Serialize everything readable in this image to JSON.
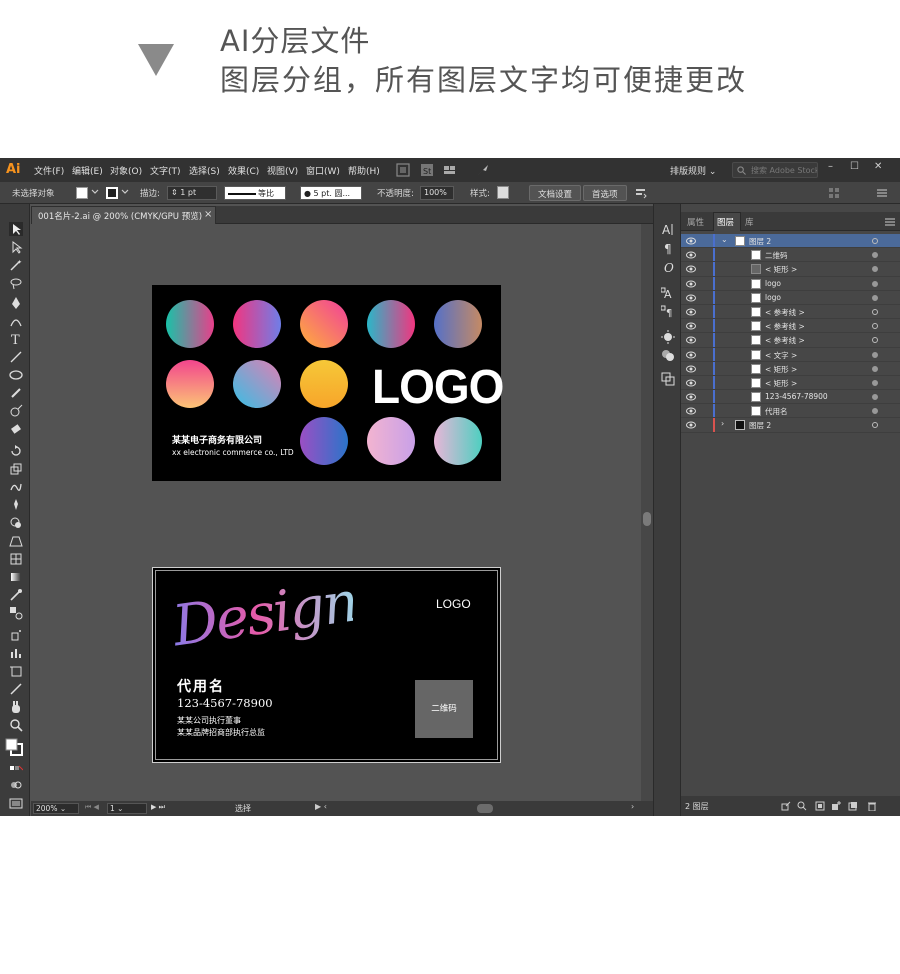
{
  "caption": {
    "line1": "AI分层文件",
    "line2": "图层分组，所有图层文字均可便捷更改",
    "arrow_icon": "down-triangle"
  },
  "menubar": {
    "app_logo": "Ai",
    "menus": [
      "文件(F)",
      "编辑(E)",
      "对象(O)",
      "文字(T)",
      "选择(S)",
      "效果(C)",
      "视图(V)",
      "窗口(W)",
      "帮助(H)"
    ],
    "workspace": "排版规则",
    "search_placeholder": "搜索 Adobe Stock"
  },
  "controlbar": {
    "selection": "未选择对象",
    "stroke_label": "描边:",
    "stroke_weight": "1 pt",
    "profile": "等比",
    "brush": "5 pt. 圆...",
    "opacity_label": "不透明度:",
    "opacity_value": "100%",
    "style_label": "样式:",
    "doc_setup": "文档设置",
    "preferences": "首选项"
  },
  "document": {
    "tab_title": "001名片-2.ai @ 200% (CMYK/GPU 预览)",
    "zoom": "200%",
    "page": "1",
    "status_tool": "选择"
  },
  "card_front": {
    "logo": "LOGO",
    "company": "某某电子商务有限公司",
    "company_en": "xx electronic commerce co., LTD"
  },
  "card_back": {
    "script_text": "Design",
    "logo": "LOGO",
    "name": "代用名",
    "phone": "123-4567-78900",
    "title1": "某某公司执行董事",
    "title2": "某某品牌招商部执行总监",
    "qr": "二维码"
  },
  "layers_panel": {
    "tabs": [
      "属性",
      "图层",
      "库"
    ],
    "active_tab": "图层",
    "footer_count": "2 图层",
    "rows": [
      {
        "label": "图层 2",
        "thumb": "white",
        "level": 0,
        "selected": true
      },
      {
        "label": "二维码",
        "thumb": "white",
        "level": 1
      },
      {
        "label": "< 矩形 >",
        "thumb": "gray",
        "level": 1
      },
      {
        "label": "logo",
        "thumb": "white",
        "level": 1
      },
      {
        "label": "logo",
        "thumb": "white",
        "level": 1
      },
      {
        "label": "< 参考线 >",
        "thumb": "white",
        "level": 1
      },
      {
        "label": "< 参考线 >",
        "thumb": "white",
        "level": 1
      },
      {
        "label": "< 参考线 >",
        "thumb": "white",
        "level": 1
      },
      {
        "label": "< 文字 >",
        "thumb": "white",
        "level": 1
      },
      {
        "label": "< 矩形 >",
        "thumb": "white",
        "level": 1
      },
      {
        "label": "< 矩形 >",
        "thumb": "white",
        "level": 1
      },
      {
        "label": "123-4567-78900",
        "thumb": "white",
        "level": 1
      },
      {
        "label": "代用名",
        "thumb": "white",
        "level": 1
      },
      {
        "label": "图层 2",
        "thumb": "white",
        "level": 0
      }
    ]
  },
  "colors": {
    "ui_dark": "#323232",
    "ui_mid": "#535353",
    "selection_blue": "#4b6a9a",
    "ai_orange": "#f7931e"
  }
}
